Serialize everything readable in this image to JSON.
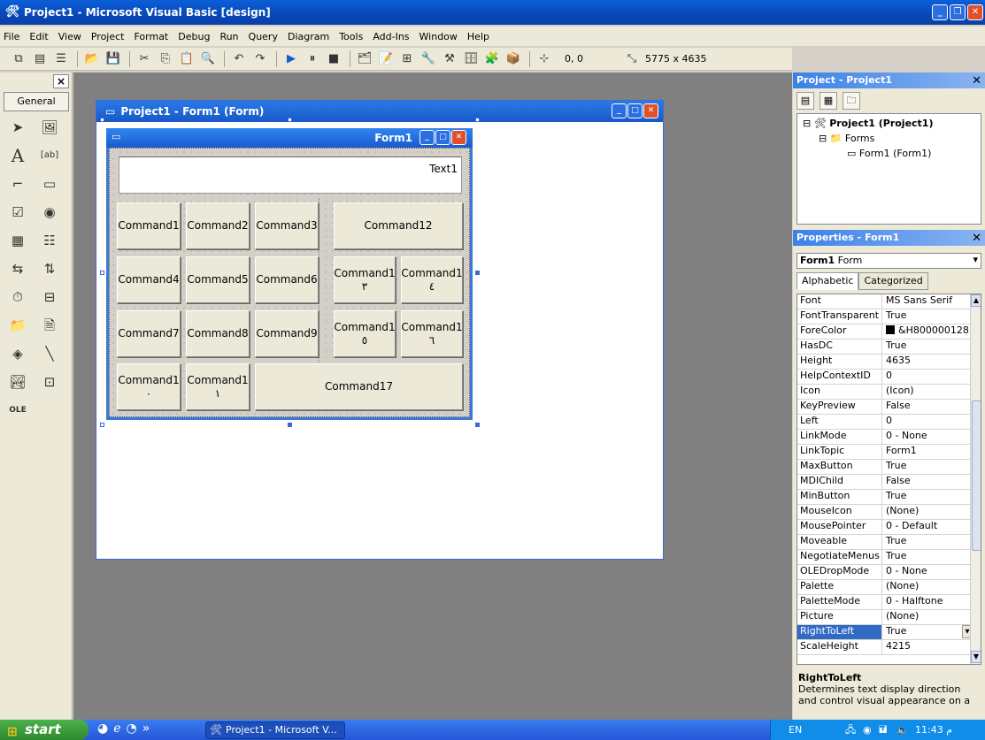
{
  "window": {
    "title": "Project1 - Microsoft Visual Basic [design]"
  },
  "menu": [
    "File",
    "Edit",
    "View",
    "Project",
    "Format",
    "Debug",
    "Run",
    "Query",
    "Diagram",
    "Tools",
    "Add-Ins",
    "Window",
    "Help"
  ],
  "toolbar": {
    "position": "0, 0",
    "size": "5775 x 4635"
  },
  "toolbox": {
    "close": "×",
    "tab": "General"
  },
  "designer": {
    "title": "Project1 - Form1 (Form)"
  },
  "form": {
    "caption": "Form1",
    "textbox": "Text1",
    "buttons": {
      "b1": "Command1",
      "b2": "Command2",
      "b3": "Command3",
      "b12": "Command12",
      "b4": "Command4",
      "b5": "Command5",
      "b6": "Command6",
      "b13a": "Command1",
      "b13b": "٣",
      "b14a": "Command1",
      "b14b": "٤",
      "b7": "Command7",
      "b8": "Command8",
      "b9": "Command9",
      "b15a": "Command1",
      "b15b": "٥",
      "b16a": "Command1",
      "b16b": "٦",
      "b10a": "Command1",
      "b10b": "٠",
      "b11a": "Command1",
      "b11b": "١",
      "b17": "Command17"
    }
  },
  "project": {
    "title": "Project - Project1",
    "root": "Project1 (Project1)",
    "folder": "Forms",
    "item": "Form1 (Form1)"
  },
  "properties": {
    "title": "Properties - Form1",
    "object_name": "Form1",
    "object_type": "Form",
    "tabs": [
      "Alphabetic",
      "Categorized"
    ],
    "rows": [
      {
        "name": "Font",
        "value": "MS Sans Serif"
      },
      {
        "name": "FontTransparent",
        "value": "True"
      },
      {
        "name": "ForeColor",
        "value": "&H800000128"
      },
      {
        "name": "HasDC",
        "value": "True"
      },
      {
        "name": "Height",
        "value": "4635"
      },
      {
        "name": "HelpContextID",
        "value": "0"
      },
      {
        "name": "Icon",
        "value": "(Icon)"
      },
      {
        "name": "KeyPreview",
        "value": "False"
      },
      {
        "name": "Left",
        "value": "0"
      },
      {
        "name": "LinkMode",
        "value": "0 - None"
      },
      {
        "name": "LinkTopic",
        "value": "Form1"
      },
      {
        "name": "MaxButton",
        "value": "True"
      },
      {
        "name": "MDIChild",
        "value": "False"
      },
      {
        "name": "MinButton",
        "value": "True"
      },
      {
        "name": "MouseIcon",
        "value": "(None)"
      },
      {
        "name": "MousePointer",
        "value": "0 - Default"
      },
      {
        "name": "Moveable",
        "value": "True"
      },
      {
        "name": "NegotiateMenus",
        "value": "True"
      },
      {
        "name": "OLEDropMode",
        "value": "0 - None"
      },
      {
        "name": "Palette",
        "value": "(None)"
      },
      {
        "name": "PaletteMode",
        "value": "0 - Halftone"
      },
      {
        "name": "Picture",
        "value": "(None)"
      },
      {
        "name": "RightToLeft",
        "value": "True"
      },
      {
        "name": "ScaleHeight",
        "value": "4215"
      }
    ],
    "desc_title": "RightToLeft",
    "desc_text": "Determines text display direction and control visual appearance on a"
  },
  "taskbar": {
    "start": "start",
    "task": "Project1 - Microsoft V...",
    "lang": "EN",
    "clock": "11:43  م",
    "chevron": "»"
  }
}
